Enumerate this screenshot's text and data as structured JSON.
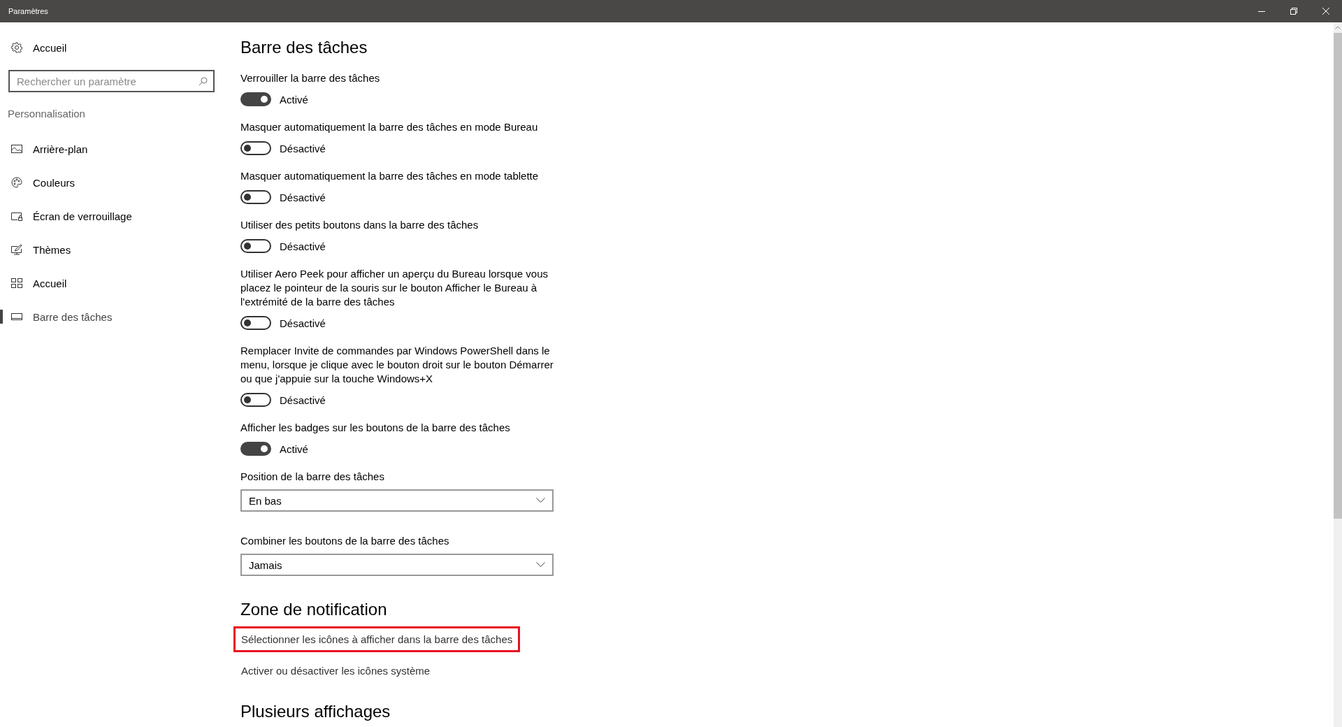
{
  "window": {
    "title": "Paramètres"
  },
  "sidebar": {
    "home": "Accueil",
    "search": {
      "placeholder": "Rechercher un paramètre"
    },
    "section": "Personnalisation",
    "items": [
      {
        "label": "Arrière-plan",
        "selected": false
      },
      {
        "label": "Couleurs",
        "selected": false
      },
      {
        "label": "Écran de verrouillage",
        "selected": false
      },
      {
        "label": "Thèmes",
        "selected": false
      },
      {
        "label": "Accueil",
        "selected": false
      },
      {
        "label": "Barre des tâches",
        "selected": true
      }
    ]
  },
  "page": {
    "title": "Barre des tâches",
    "settings": [
      {
        "label": "Verrouiller la barre des tâches",
        "on": true,
        "state": "Activé"
      },
      {
        "label": "Masquer automatiquement la barre des tâches en mode Bureau",
        "on": false,
        "state": "Désactivé"
      },
      {
        "label": "Masquer automatiquement la barre des tâches en mode tablette",
        "on": false,
        "state": "Désactivé"
      },
      {
        "label": "Utiliser des petits boutons dans la barre des tâches",
        "on": false,
        "state": "Désactivé"
      },
      {
        "label": "Utiliser Aero Peek pour afficher un aperçu du Bureau lorsque vous placez le pointeur de la souris sur le bouton Afficher le Bureau à l'extrémité de la barre des tâches",
        "on": false,
        "state": "Désactivé"
      },
      {
        "label": "Remplacer Invite de commandes par Windows PowerShell dans le menu, lorsque je clique avec le bouton droit sur le bouton Démarrer ou que j'appuie sur la touche Windows+X",
        "on": false,
        "state": "Désactivé"
      },
      {
        "label": "Afficher les badges sur les boutons de la barre des tâches",
        "on": true,
        "state": "Activé"
      }
    ],
    "dropdowns": [
      {
        "label": "Position de la barre des tâches",
        "value": "En bas"
      },
      {
        "label": "Combiner les boutons de la barre des tâches",
        "value": "Jamais"
      }
    ],
    "notification": {
      "title": "Zone de notification",
      "links": [
        {
          "label": "Sélectionner les icônes à afficher dans la barre des tâches",
          "highlighted": true
        },
        {
          "label": "Activer ou désactiver les icônes système",
          "highlighted": false
        }
      ]
    },
    "next_section": {
      "title": "Plusieurs affichages"
    }
  }
}
